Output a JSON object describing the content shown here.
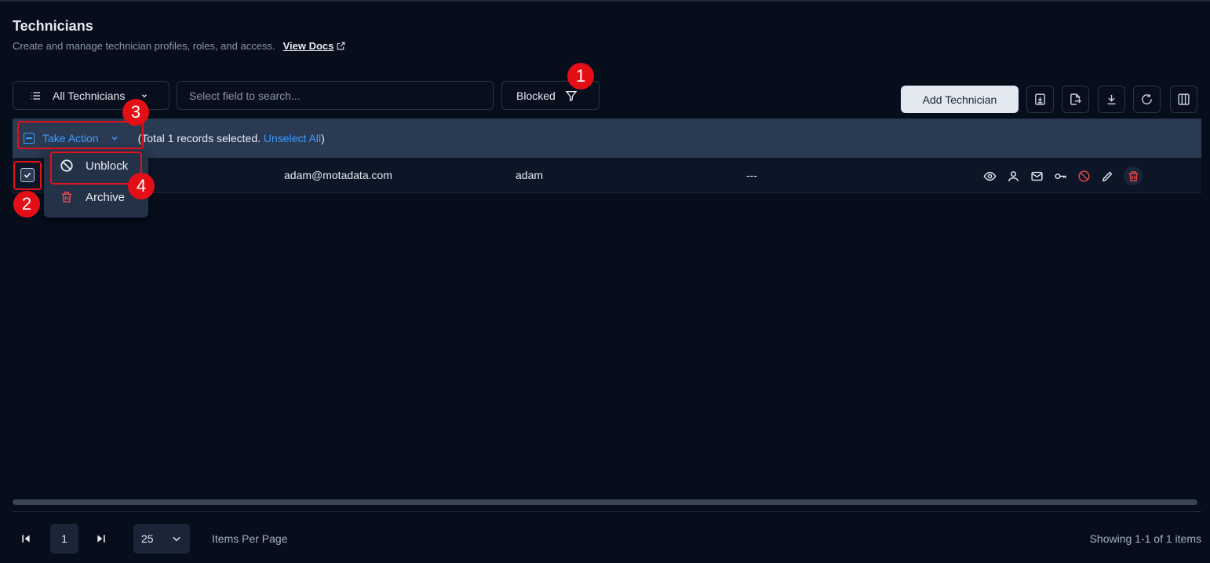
{
  "header": {
    "title": "Technicians",
    "subtitle": "Create and manage technician profiles, roles, and access.",
    "docs_link": "View Docs"
  },
  "toolbar": {
    "view_label": "All Technicians",
    "search_placeholder": "Select field to search...",
    "filter_label": "Blocked",
    "add_button": "Add Technician",
    "icon_buttons": [
      "import-icon",
      "export-icon",
      "download-icon",
      "refresh-icon",
      "columns-icon"
    ]
  },
  "selection": {
    "take_action": "Take Action",
    "info_prefix": "(Total 1 records selected.",
    "unselect_all": "Unselect All",
    "info_suffix": ")"
  },
  "dropdown": {
    "items": [
      {
        "label": "Unblock",
        "icon": "ban-icon"
      },
      {
        "label": "Archive",
        "icon": "trash-icon"
      }
    ]
  },
  "table": {
    "rows": [
      {
        "checked": true,
        "email": "adam@motadata.com",
        "name": "adam",
        "extra": "---",
        "actions": [
          "eye-icon",
          "user-icon",
          "mail-icon",
          "key-icon",
          "ban-icon",
          "pencil-icon",
          "trash-icon"
        ]
      }
    ]
  },
  "annotations": [
    "1",
    "2",
    "3",
    "4"
  ],
  "pagination": {
    "current_page": "1",
    "per_page": "25",
    "per_page_label": "Items Per Page",
    "showing": "Showing 1-1 of 1 items"
  },
  "colors": {
    "background": "#060e1c",
    "accent": "#3d9bff",
    "annotation": "#e40f16",
    "danger": "#e5484d"
  }
}
